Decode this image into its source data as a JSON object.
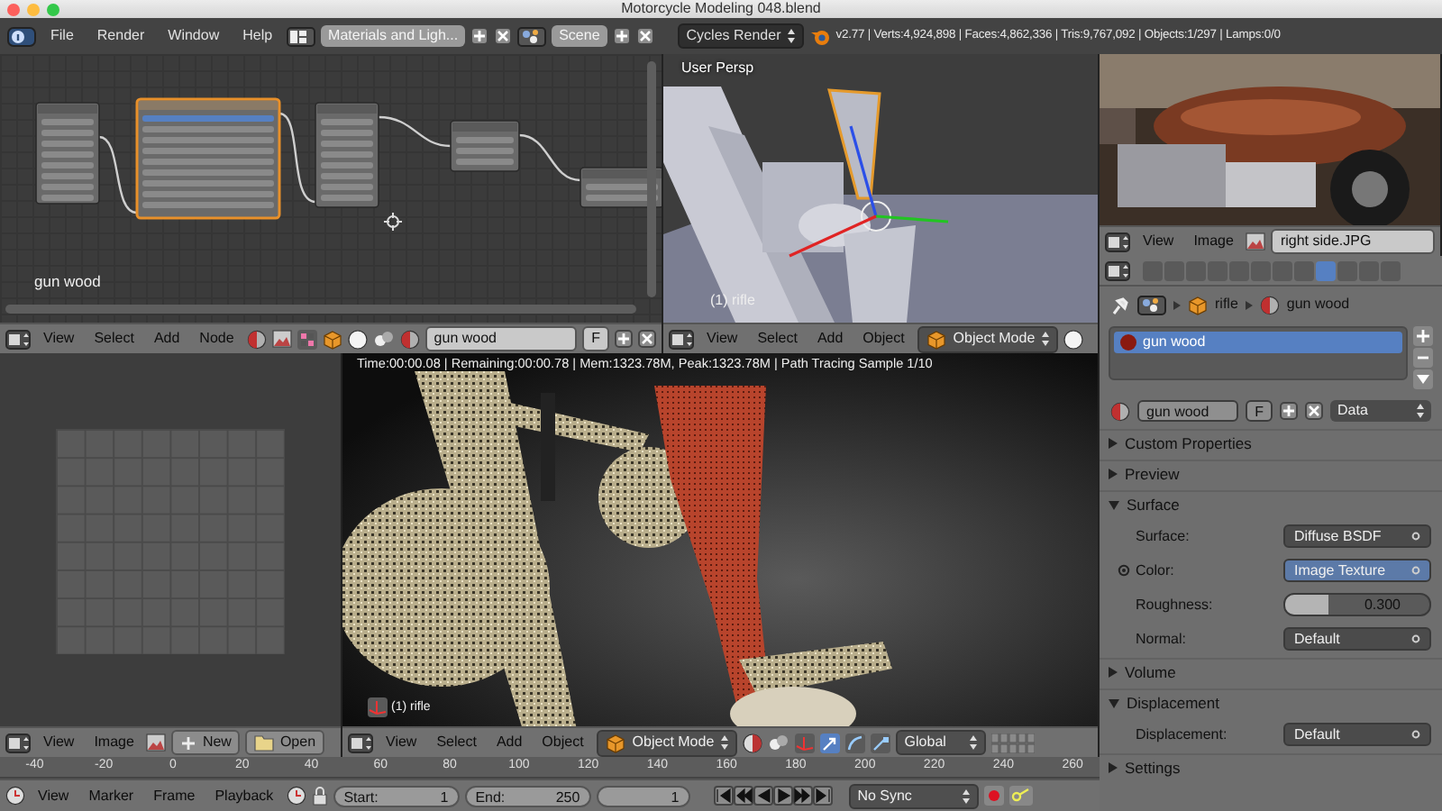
{
  "window": {
    "title": "Motorcycle Modeling 048.blend"
  },
  "top_bar": {
    "menus": [
      "File",
      "Render",
      "Window",
      "Help"
    ],
    "screen_layout": "Materials and Ligh...",
    "scene": "Scene",
    "render_engine": "Cycles Render",
    "stats": "v2.77 | Verts:4,924,898 | Faces:4,862,336 | Tris:9,767,092 | Objects:1/297 | Lamps:0/0"
  },
  "node_editor": {
    "nodes": [
      {
        "selected": false
      },
      {
        "selected": true
      },
      {
        "selected": false
      },
      {
        "selected": false
      },
      {
        "selected": false
      }
    ],
    "material_label": "gun wood",
    "header": {
      "menus": [
        "View",
        "Select",
        "Add",
        "Node"
      ],
      "material": "gun wood",
      "fake_user": "F"
    }
  },
  "viewport_3d": {
    "view_label": "User Persp",
    "object_label": "(1) rifle",
    "header": {
      "menus": [
        "View",
        "Select",
        "Add",
        "Object"
      ],
      "mode": "Object Mode"
    }
  },
  "image_viewer": {
    "header": {
      "menus": [
        "View",
        "Image"
      ],
      "image": "right side.JPG"
    }
  },
  "properties": {
    "tabs": [
      {
        "selected": false
      },
      {
        "selected": false
      },
      {
        "selected": false
      },
      {
        "selected": false
      },
      {
        "selected": false
      },
      {
        "selected": false
      },
      {
        "selected": false
      },
      {
        "selected": false
      },
      {
        "selected": true
      },
      {
        "selected": false
      },
      {
        "selected": false
      },
      {
        "selected": false
      }
    ],
    "breadcrumb": [
      "rifle",
      "gun wood"
    ],
    "material_slots": [
      {
        "name": "gun wood",
        "selected": true
      }
    ],
    "material": "gun wood",
    "fake_user": "F",
    "link": "Data",
    "panels": [
      {
        "title": "Custom Properties",
        "expanded": false
      },
      {
        "title": "Preview",
        "expanded": false
      },
      {
        "title": "Surface",
        "expanded": true,
        "fields": [
          {
            "label": "Surface:",
            "kind": "menu",
            "value": "Diffuse BSDF",
            "linked": false
          },
          {
            "label": "Color:",
            "kind": "menu",
            "value": "Image Texture",
            "linked": true
          },
          {
            "label": "Roughness:",
            "kind": "slider",
            "value": "0.300",
            "level": 0.3,
            "linked": false
          },
          {
            "label": "Normal:",
            "kind": "menu",
            "value": "Default",
            "linked": false
          }
        ]
      },
      {
        "title": "Volume",
        "expanded": false
      },
      {
        "title": "Displacement",
        "expanded": true,
        "fields": [
          {
            "label": "Displacement:",
            "kind": "menu",
            "value": "Default",
            "linked": false
          }
        ]
      },
      {
        "title": "Settings",
        "expanded": false
      }
    ]
  },
  "uv_editor": {
    "header": {
      "menus": [
        "View",
        "Image"
      ],
      "buttons": [
        "New",
        "Open"
      ]
    }
  },
  "render_view": {
    "info": "Time:00:00.08 | Remaining:00:00.78 | Mem:1323.78M, Peak:1323.78M | Path Tracing Sample 1/10",
    "object_label": "(1) rifle",
    "header": {
      "menus": [
        "View",
        "Select",
        "Add",
        "Object"
      ],
      "mode": "Object Mode",
      "orientation": "Global"
    }
  },
  "timeline": {
    "ruler": [
      "-40",
      "-20",
      "0",
      "20",
      "40",
      "60",
      "80",
      "100",
      "120",
      "140",
      "160",
      "180",
      "200",
      "220",
      "240",
      "260"
    ],
    "menus": [
      "View",
      "Marker",
      "Frame",
      "Playback"
    ],
    "start": {
      "label": "Start:",
      "value": "1"
    },
    "end": {
      "label": "End:",
      "value": "250"
    },
    "current": "1",
    "sync": "No Sync"
  }
}
